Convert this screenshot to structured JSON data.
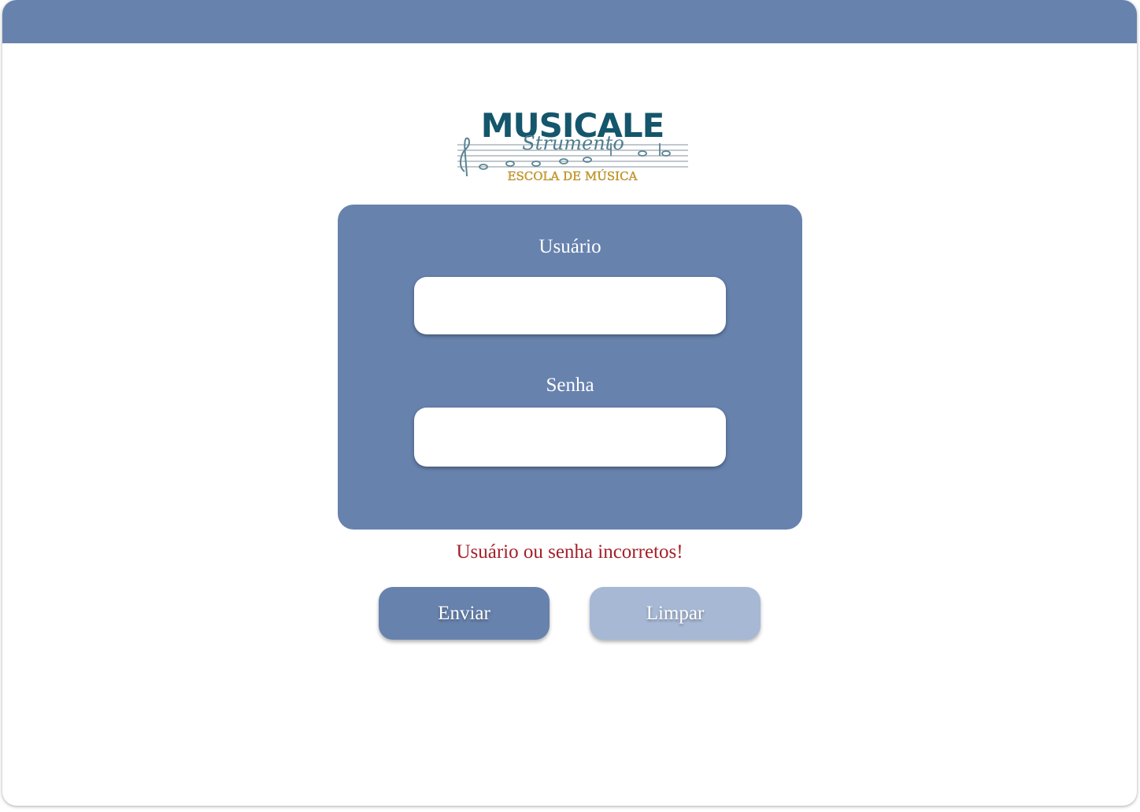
{
  "brand": {
    "logo_title": "MUSICALE",
    "logo_script": "Strumento",
    "logo_subtitle": "ESCOLA DE MÚSICA"
  },
  "login": {
    "user_label": "Usuário",
    "user_value": "",
    "password_label": "Senha",
    "password_value": "",
    "error_message": "Usuário ou senha incorretos!"
  },
  "actions": {
    "submit_label": "Enviar",
    "clear_label": "Limpar"
  },
  "colors": {
    "primary": "#6782ad",
    "secondary": "#a7b8d4",
    "error": "#a3202a",
    "logo_teal": "#14566b",
    "logo_gold": "#d9a520"
  }
}
